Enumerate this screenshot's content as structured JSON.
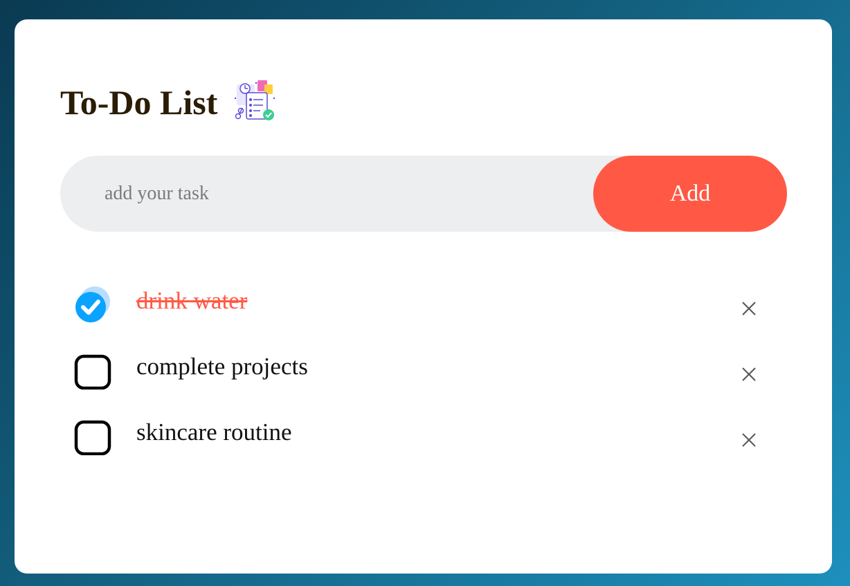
{
  "header": {
    "title": "To-Do List",
    "icon": "task-list-illustration-icon"
  },
  "task_input": {
    "value": "",
    "placeholder": "add your task"
  },
  "add_button": {
    "label": "Add"
  },
  "tasks": [
    {
      "text": "drink water",
      "completed": true
    },
    {
      "text": "complete projects",
      "completed": false
    },
    {
      "text": "skincare routine",
      "completed": false
    }
  ],
  "icons": {
    "checked": "checked-circle-icon",
    "unchecked": "unchecked-box-icon",
    "delete": "close-icon"
  },
  "colors": {
    "accent": "#ff5945",
    "title": "#2b1c05",
    "check": "#0aa3ff",
    "input_bg": "#edeef0",
    "background_start": "#0a3a52",
    "background_end": "#1d90bd"
  }
}
